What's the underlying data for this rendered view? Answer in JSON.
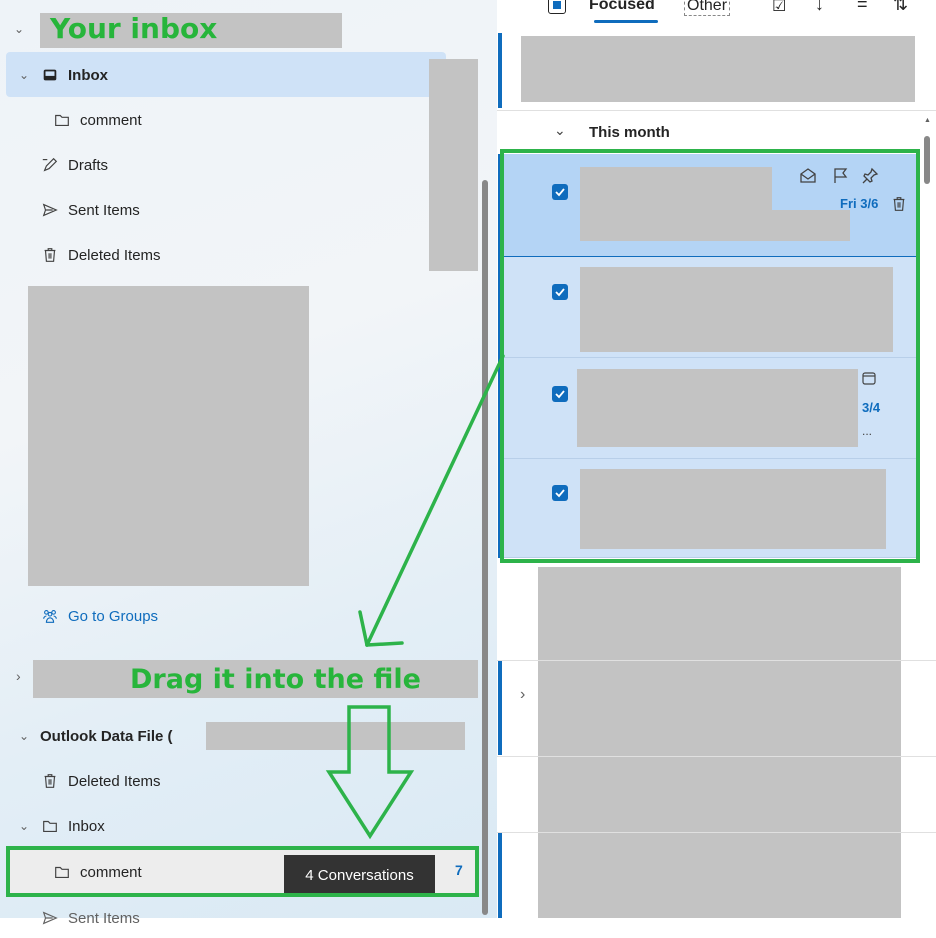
{
  "annotations": {
    "your_inbox": "Your inbox",
    "drag_text": "Drag it into the file"
  },
  "toolbar": {
    "focused": "Focused",
    "other": "Other"
  },
  "nav": {
    "inbox": "Inbox",
    "comment": "comment",
    "drafts": "Drafts",
    "sent": "Sent Items",
    "deleted": "Deleted Items",
    "go_groups": "Go to Groups",
    "data_file": "Outlook Data File (",
    "df_deleted": "Deleted Items",
    "df_inbox": "Inbox",
    "df_comment": "comment",
    "df_comment_count": "7",
    "df_sent": "Sent Items"
  },
  "tooltip": "4 Conversations",
  "list": {
    "group_header": "This month",
    "item1_date": "Fri 3/6",
    "item3_date": "3/4",
    "item3_more": "..."
  },
  "colors": {
    "accent": "#0f6cbd",
    "annotation_green": "#2db34a",
    "redaction": "#c3c3c3"
  }
}
